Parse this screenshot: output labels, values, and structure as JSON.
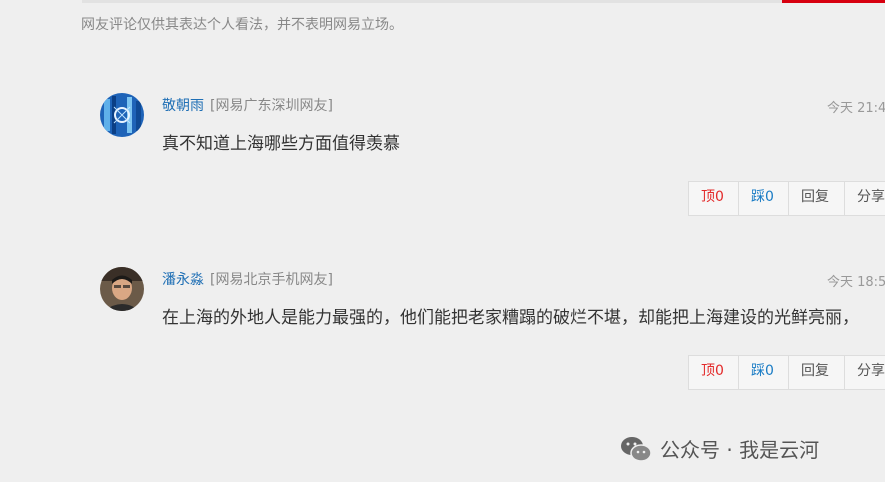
{
  "disclaimer": "网友评论仅供其表达个人看法，并不表明网易立场。",
  "comments": [
    {
      "username": "敬朝雨",
      "location": "[网易广东深圳网友]",
      "time": "今天 21:4",
      "text": "真不知道上海哪些方面值得羡慕",
      "actions": {
        "up": "顶0",
        "down": "踩0",
        "reply": "回复",
        "share": "分享"
      }
    },
    {
      "username": "潘永淼",
      "location": "[网易北京手机网友]",
      "time": "今天 18:5",
      "text": "在上海的外地人是能力最强的，他们能把老家糟蹋的破烂不堪，却能把上海建设的光鲜亮丽，",
      "actions": {
        "up": "顶0",
        "down": "踩0",
        "reply": "回复",
        "share": "分享"
      }
    }
  ],
  "watermark": {
    "text": "公众号 · 我是云河",
    "icon": "wechat-icon"
  },
  "colors": {
    "up": "#e32a2a",
    "down": "#1a7cc5",
    "username": "#1f6fb5",
    "accent": "#d7000f"
  }
}
